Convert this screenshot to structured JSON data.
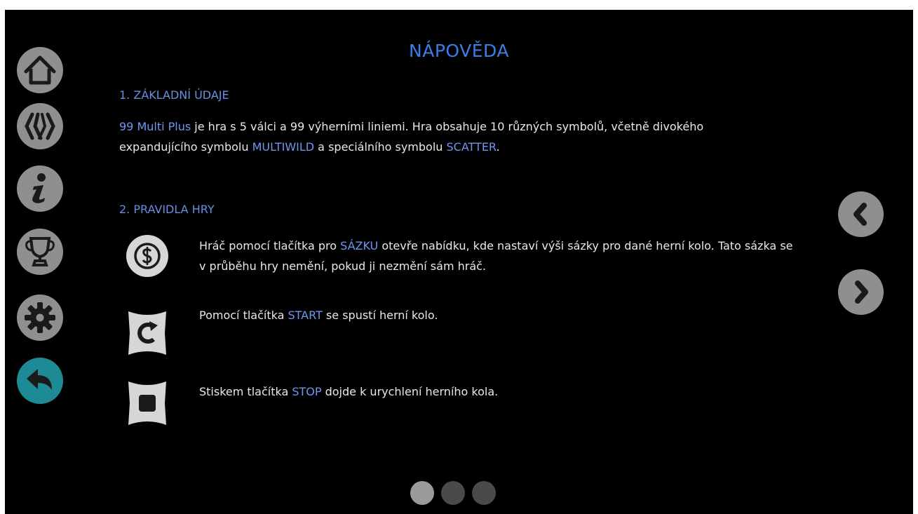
{
  "title": "NÁPOVĚDA",
  "section1": {
    "heading": "1. ZÁKLADNÍ ÚDAJE",
    "line1": [
      {
        "text": "99 Multi Plus",
        "hl": true
      },
      {
        "text": " je hra s 5 válci a 99 výherními liniemi. Hra obsahuje 10 různých symbolů, včetně divokého",
        "hl": false
      }
    ],
    "line2": [
      {
        "text": "expandujícího symbolu ",
        "hl": false
      },
      {
        "text": "MULTIWILD",
        "hl": true
      },
      {
        "text": " a speciálního symbolu ",
        "hl": false
      },
      {
        "text": "SCATTER",
        "hl": true
      },
      {
        "text": ".",
        "hl": false
      }
    ]
  },
  "section2": {
    "heading": "2. PRAVIDLA HRY",
    "bet": {
      "line1": [
        {
          "text": "Hráč pomocí tlačítka pro ",
          "hl": false
        },
        {
          "text": "SÁZKU",
          "hl": true
        },
        {
          "text": " otevře nabídku, kde nastaví výši sázky pro dané herní kolo. Tato sázka se",
          "hl": false
        }
      ],
      "line2": [
        {
          "text": "v průběhu hry nemění, pokud ji nezmění sám hráč.",
          "hl": false
        }
      ]
    },
    "start": {
      "line1": [
        {
          "text": "Pomocí tlačítka ",
          "hl": false
        },
        {
          "text": "START",
          "hl": true
        },
        {
          "text": " se spustí herní kolo.",
          "hl": false
        }
      ]
    },
    "stop": {
      "line1": [
        {
          "text": "Stiskem tlačítka ",
          "hl": false
        },
        {
          "text": "STOP",
          "hl": true
        },
        {
          "text": " dojde k urychlení herního kola.",
          "hl": false
        }
      ]
    }
  },
  "sidebar": {
    "items": [
      {
        "icon": "home-icon"
      },
      {
        "icon": "paytable-icon"
      },
      {
        "icon": "info-icon"
      },
      {
        "icon": "trophy-icon"
      },
      {
        "icon": "settings-icon"
      },
      {
        "icon": "back-icon",
        "active": true
      }
    ]
  },
  "pagination": {
    "pages": 3,
    "current": 1
  },
  "colors": {
    "background": "#000000",
    "button": "#8f8f8f",
    "active_button": "#1e8a96",
    "title": "#3a7ee6",
    "highlight": "#6f97ee",
    "text": "#e8e8e8",
    "icon_fill": "#d6d6d6"
  }
}
